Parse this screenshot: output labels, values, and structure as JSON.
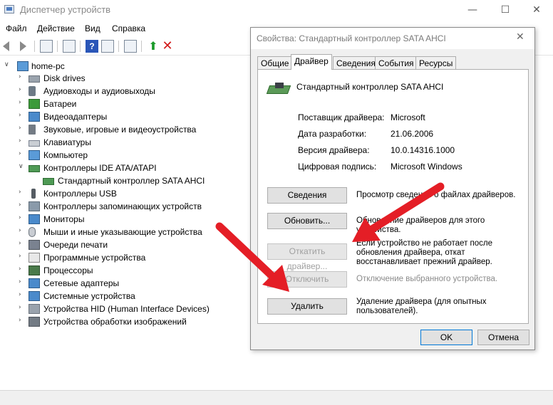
{
  "window": {
    "title": "Диспетчер устройств",
    "controls": {
      "minimize": "—",
      "maximize": "☐",
      "close": "✕"
    }
  },
  "menu": [
    "Файл",
    "Действие",
    "Вид",
    "Справка"
  ],
  "toolbar": {
    "help": "?",
    "remove": "✕",
    "update": "⬆"
  },
  "tree": {
    "root": "home-pc",
    "items": [
      {
        "label": "Disk drives",
        "icon": "disk-drive-icon",
        "expanded": false
      },
      {
        "label": "Аудиовходы и аудиовыходы",
        "icon": "audio-io-icon",
        "expanded": false
      },
      {
        "label": "Батареи",
        "icon": "battery-icon",
        "expanded": false
      },
      {
        "label": "Видеоадаптеры",
        "icon": "video-adapter-icon",
        "expanded": false
      },
      {
        "label": "Звуковые, игровые и видеоустройства",
        "icon": "sound-device-icon",
        "expanded": false
      },
      {
        "label": "Клавиатуры",
        "icon": "keyboard-icon",
        "expanded": false
      },
      {
        "label": "Компьютер",
        "icon": "computer-icon",
        "expanded": false
      },
      {
        "label": "Контроллеры IDE ATA/ATAPI",
        "icon": "ide-controller-icon",
        "expanded": true
      },
      {
        "label": "Стандартный контроллер SATA AHCI",
        "icon": "ide-controller-icon",
        "child": true
      },
      {
        "label": "Контроллеры USB",
        "icon": "usb-icon",
        "expanded": false
      },
      {
        "label": "Контроллеры запоминающих устройств",
        "icon": "storage-controller-icon",
        "expanded": false
      },
      {
        "label": "Мониторы",
        "icon": "monitor-icon",
        "expanded": false
      },
      {
        "label": "Мыши и иные указывающие устройства",
        "icon": "mouse-icon",
        "expanded": false
      },
      {
        "label": "Очереди печати",
        "icon": "printer-icon",
        "expanded": false
      },
      {
        "label": "Программные устройства",
        "icon": "software-device-icon",
        "expanded": false
      },
      {
        "label": "Процессоры",
        "icon": "processor-icon",
        "expanded": false
      },
      {
        "label": "Сетевые адаптеры",
        "icon": "network-adapter-icon",
        "expanded": false
      },
      {
        "label": "Системные устройства",
        "icon": "system-device-icon",
        "expanded": false
      },
      {
        "label": "Устройства HID (Human Interface Devices)",
        "icon": "hid-icon",
        "expanded": false
      },
      {
        "label": "Устройства обработки изображений",
        "icon": "imaging-device-icon",
        "expanded": false
      }
    ]
  },
  "dialog": {
    "title": "Свойства: Стандартный контроллер SATA AHCI",
    "close": "✕",
    "tabs": [
      "Общие",
      "Драйвер",
      "Сведения",
      "События",
      "Ресурсы"
    ],
    "active_tab": "Драйвер",
    "device_name": "Стандартный контроллер SATA AHCI",
    "info": [
      {
        "label": "Поставщик драйвера:",
        "value": "Microsoft"
      },
      {
        "label": "Дата разработки:",
        "value": "21.06.2006"
      },
      {
        "label": "Версия драйвера:",
        "value": "10.0.14316.1000"
      },
      {
        "label": "Цифровая подпись:",
        "value": "Microsoft Windows"
      }
    ],
    "actions": [
      {
        "button": "Сведения",
        "desc": "Просмотр сведений о файлах драйверов.",
        "disabled": false
      },
      {
        "button": "Обновить...",
        "desc": "Обновление драйверов для этого устройства.",
        "disabled": false
      },
      {
        "button": "Откатить драйвер...",
        "desc": "Если устройство не работает после обновления драйвера, откат восстанавливает прежний драйвер.",
        "disabled": true
      },
      {
        "button": "Отключить",
        "desc": "Отключение выбранного устройства.",
        "disabled": true
      },
      {
        "button": "Удалить",
        "desc": "Удаление драйвера (для опытных пользователей).",
        "disabled": false
      }
    ],
    "ok": "OK",
    "cancel": "Отмена"
  },
  "colors": {
    "annotation_arrow": "#e41e26",
    "accent_blue": "#0078d7"
  }
}
